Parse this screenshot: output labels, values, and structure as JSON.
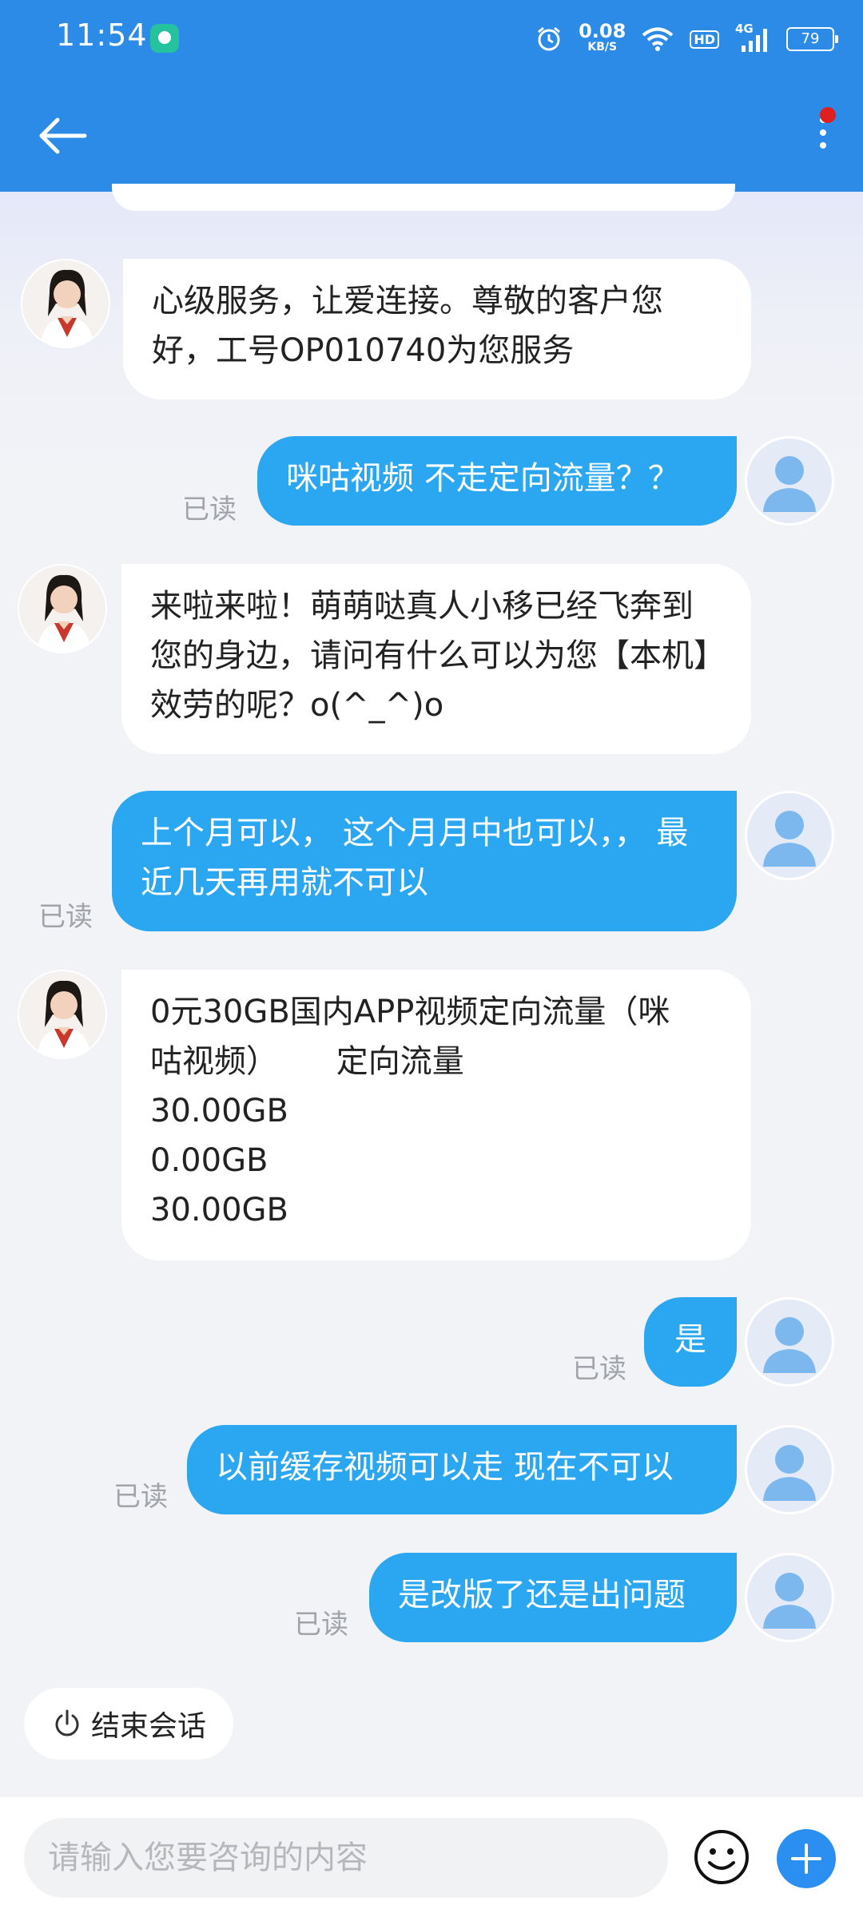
{
  "status_bar": {
    "time": "11:54",
    "net_speed_value": "0.08",
    "net_speed_unit": "KB/S",
    "hd_label": "HD",
    "signal_label": "4G",
    "battery": "79"
  },
  "messages": [
    {
      "sender": "agent",
      "text": "心级服务，让爱连接。尊敬的客户您好，工号OP010740为您服务"
    },
    {
      "sender": "user",
      "text": "咪咕视频 不走定向流量？？",
      "status": "已读"
    },
    {
      "sender": "agent",
      "text": "来啦来啦！萌萌哒真人小移已经飞奔到您的身边，请问有什么可以为您【本机】效劳的呢？o(^_^)o"
    },
    {
      "sender": "user",
      "text": "上个月可以， 这个月月中也可以，， 最近几天再用就不可以",
      "status": "已读"
    },
    {
      "sender": "agent",
      "lines": [
        "0元30GB国内APP视频定向流量（咪",
        "咕视频）　　 定向流量",
        "30.00GB",
        "0.00GB",
        "30.00GB"
      ]
    },
    {
      "sender": "user",
      "text": "是",
      "status": "已读"
    },
    {
      "sender": "user",
      "text": "以前缓存视频可以走 现在不可以",
      "status": "已读"
    },
    {
      "sender": "user",
      "text": "是改版了还是出问题",
      "status": "已读"
    }
  ],
  "end_session_label": "结束会话",
  "input": {
    "placeholder": "请输入您要咨询的内容"
  },
  "colors": {
    "header": "#2b8be6",
    "user_bubble": "#2aa7f0",
    "agent_bubble": "#ffffff",
    "notification_dot": "#e02020"
  }
}
